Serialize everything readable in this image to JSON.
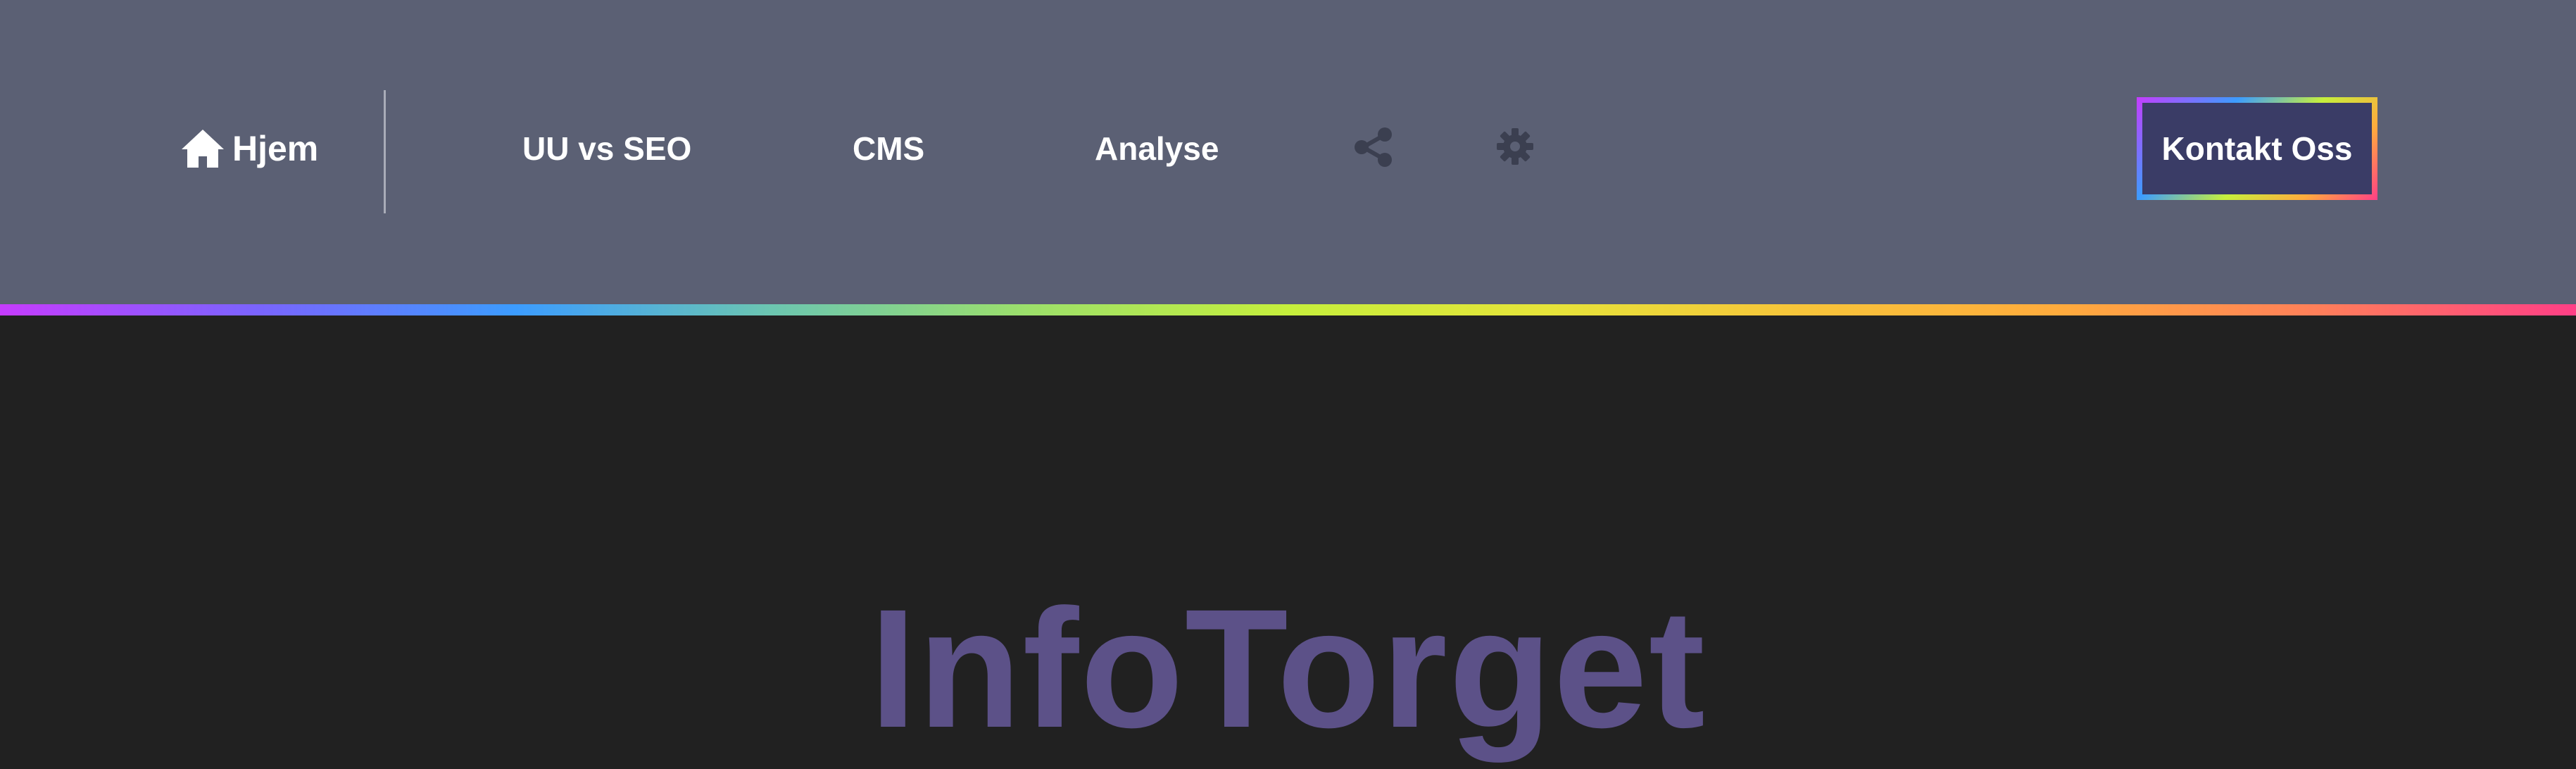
{
  "colors": {
    "header_bg": "#5b6074",
    "page_bg": "#212121",
    "title_color": "#5c5188",
    "cta_bg": "#3a3c66",
    "icon_color": "#3b3f50"
  },
  "nav": {
    "home": {
      "label": "Hjem",
      "icon": "home-icon"
    },
    "items": [
      {
        "label": "UU vs SEO"
      },
      {
        "label": "CMS"
      },
      {
        "label": "Analyse"
      }
    ],
    "share_icon": "share-icon",
    "settings_icon": "gear-icon",
    "cta_label": "Kontakt Oss"
  },
  "hero": {
    "title": "InfoTorget"
  }
}
